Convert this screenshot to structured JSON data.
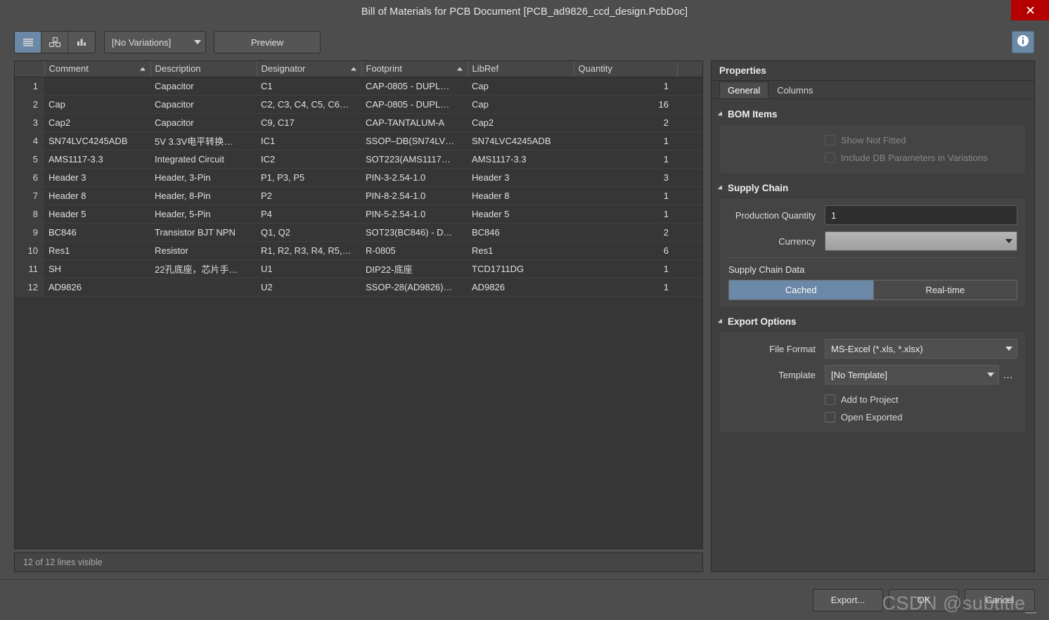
{
  "window": {
    "title": "Bill of Materials for PCB Document [PCB_ad9826_ccd_design.PcbDoc]",
    "close_label": "close-icon"
  },
  "toolbar": {
    "view_buttons": [
      {
        "name": "list-view",
        "icon": "list-icon",
        "active": true
      },
      {
        "name": "structured-view",
        "icon": "blocks-icon",
        "active": false
      },
      {
        "name": "chart-view",
        "icon": "bar-chart-icon",
        "active": false
      }
    ],
    "variations_value": "[No Variations]",
    "preview_label": "Preview",
    "info_label": "info-icon"
  },
  "grid": {
    "columns": [
      {
        "key": "num",
        "label": "",
        "sorted": false
      },
      {
        "key": "comment",
        "label": "Comment",
        "sorted": true
      },
      {
        "key": "description",
        "label": "Description",
        "sorted": false
      },
      {
        "key": "designator",
        "label": "Designator",
        "sorted": true
      },
      {
        "key": "footprint",
        "label": "Footprint",
        "sorted": true
      },
      {
        "key": "libref",
        "label": "LibRef",
        "sorted": false
      },
      {
        "key": "quantity",
        "label": "Quantity",
        "sorted": false
      },
      {
        "key": "blank",
        "label": "",
        "sorted": false
      }
    ],
    "rows": [
      {
        "num": "1",
        "comment": "",
        "description": "Capacitor",
        "designator": "C1",
        "footprint": "CAP-0805 - DUPL…",
        "libref": "Cap",
        "quantity": "1"
      },
      {
        "num": "2",
        "comment": "Cap",
        "description": "Capacitor",
        "designator": "C2, C3, C4, C5, C6…",
        "footprint": "CAP-0805 - DUPL…",
        "libref": "Cap",
        "quantity": "16"
      },
      {
        "num": "3",
        "comment": "Cap2",
        "description": "Capacitor",
        "designator": "C9, C17",
        "footprint": "CAP-TANTALUM-A",
        "libref": "Cap2",
        "quantity": "2"
      },
      {
        "num": "4",
        "comment": "SN74LVC4245ADB",
        "description": "5V 3.3V电平转换…",
        "designator": "IC1",
        "footprint": "SSOP–DB(SN74LV…",
        "libref": "SN74LVC4245ADB",
        "quantity": "1"
      },
      {
        "num": "5",
        "comment": "AMS1117-3.3",
        "description": "Integrated Circuit",
        "designator": "IC2",
        "footprint": "SOT223(AMS1117…",
        "libref": "AMS1117-3.3",
        "quantity": "1"
      },
      {
        "num": "6",
        "comment": "Header 3",
        "description": "Header, 3-Pin",
        "designator": "P1, P3, P5",
        "footprint": "PIN-3-2.54-1.0",
        "libref": "Header 3",
        "quantity": "3"
      },
      {
        "num": "7",
        "comment": "Header 8",
        "description": "Header, 8-Pin",
        "designator": "P2",
        "footprint": "PIN-8-2.54-1.0",
        "libref": "Header 8",
        "quantity": "1"
      },
      {
        "num": "8",
        "comment": "Header 5",
        "description": "Header, 5-Pin",
        "designator": "P4",
        "footprint": "PIN-5-2.54-1.0",
        "libref": "Header 5",
        "quantity": "1"
      },
      {
        "num": "9",
        "comment": "BC846",
        "description": "Transistor BJT NPN",
        "designator": "Q1, Q2",
        "footprint": "SOT23(BC846) - D…",
        "libref": "BC846",
        "quantity": "2"
      },
      {
        "num": "10",
        "comment": "Res1",
        "description": "Resistor",
        "designator": "R1, R2, R3, R4, R5,…",
        "footprint": "R-0805",
        "libref": "Res1",
        "quantity": "6"
      },
      {
        "num": "11",
        "comment": "SH",
        "description": "22孔底座，芯片手…",
        "designator": "U1",
        "footprint": "DIP22-底座",
        "libref": "TCD1711DG",
        "quantity": "1"
      },
      {
        "num": "12",
        "comment": "AD9826",
        "description": "",
        "designator": "U2",
        "footprint": "SSOP-28(AD9826)…",
        "libref": "AD9826",
        "quantity": "1"
      }
    ],
    "status": "12 of 12 lines visible"
  },
  "properties": {
    "header": "Properties",
    "tabs": [
      {
        "label": "General",
        "active": true
      },
      {
        "label": "Columns",
        "active": false
      }
    ],
    "bom_items": {
      "title": "BOM Items",
      "checkboxes": [
        {
          "label": "Show Not Fitted",
          "checked": false,
          "disabled": true
        },
        {
          "label": "Include DB Parameters in Variations",
          "checked": false,
          "disabled": true
        }
      ]
    },
    "supply_chain": {
      "title": "Supply Chain",
      "production_quantity_label": "Production Quantity",
      "production_quantity_value": "1",
      "currency_label": "Currency",
      "currency_value": "",
      "supply_chain_data_label": "Supply Chain Data",
      "segments": [
        {
          "label": "Cached",
          "active": true
        },
        {
          "label": "Real-time",
          "active": false
        }
      ]
    },
    "export_options": {
      "title": "Export Options",
      "file_format_label": "File Format",
      "file_format_value": "MS-Excel (*.xls, *.xlsx)",
      "template_label": "Template",
      "template_value": "[No Template]",
      "template_browse": "…",
      "checkboxes": [
        {
          "label": "Add to Project",
          "checked": false
        },
        {
          "label": "Open Exported",
          "checked": false
        }
      ]
    }
  },
  "footer": {
    "export_label": "Export...",
    "ok_label": "OK",
    "cancel_label": "Cancel",
    "watermark": "CSDN @subtitle_"
  },
  "colors": {
    "accent": "#6b88a6",
    "close": "#b40000",
    "window_bg": "#4d4d4d",
    "grid_bg": "#363636"
  }
}
